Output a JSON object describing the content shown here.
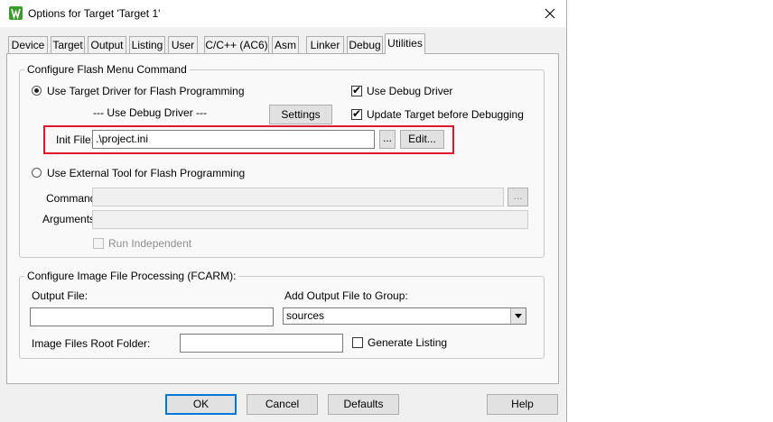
{
  "window": {
    "title": "Options for Target 'Target 1'"
  },
  "tabs": [
    {
      "label": "Device"
    },
    {
      "label": "Target"
    },
    {
      "label": "Output"
    },
    {
      "label": "Listing"
    },
    {
      "label": "User"
    },
    {
      "label": "C/C++ (AC6)"
    },
    {
      "label": "Asm"
    },
    {
      "label": "Linker"
    },
    {
      "label": "Debug"
    },
    {
      "label": "Utilities"
    }
  ],
  "active_tab": "Utilities",
  "flash_group": {
    "legend": "Configure Flash Menu Command",
    "use_target_driver": {
      "label": "Use Target Driver for Flash Programming",
      "checked": true
    },
    "driver_dropdown": "--- Use Debug Driver ---",
    "settings_label": "Settings",
    "use_debug_driver": {
      "label": "Use Debug Driver",
      "checked": true
    },
    "update_target": {
      "label": "Update Target before Debugging",
      "checked": true
    },
    "init_file": {
      "label": "Init File:",
      "value": ".\\project.ini",
      "browse_label": "...",
      "edit_label": "Edit..."
    },
    "use_external_tool": {
      "label": "Use External Tool for Flash Programming",
      "checked": false
    },
    "command": {
      "label": "Command:",
      "value": "",
      "browse_label": "..."
    },
    "arguments": {
      "label": "Arguments:",
      "value": ""
    },
    "run_independent": {
      "label": "Run Independent",
      "checked": false
    }
  },
  "image_group": {
    "legend": "Configure Image File Processing (FCARM):",
    "output_file": {
      "label": "Output File:",
      "value": ""
    },
    "add_output": {
      "label": "Add Output File  to Group:",
      "value": "sources"
    },
    "root_folder": {
      "label": "Image Files Root Folder:",
      "value": ""
    },
    "generate_listing": {
      "label": "Generate Listing",
      "checked": false
    }
  },
  "buttons": {
    "ok": "OK",
    "cancel": "Cancel",
    "defaults": "Defaults",
    "help": "Help"
  },
  "colors": {
    "highlight": "#e0182d",
    "app_icon": "#3c9a2f",
    "default_button_border": "#0078d7"
  }
}
